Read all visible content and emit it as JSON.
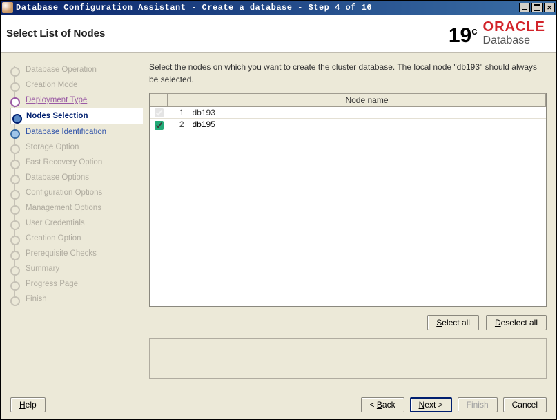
{
  "titlebar": {
    "text": "Database Configuration Assistant - Create a database - Step 4 of 16"
  },
  "header": {
    "page_title": "Select List of Nodes",
    "version_main": "19",
    "version_sup": "c",
    "brand_name": "ORACLE",
    "brand_sub": "Database"
  },
  "sidebar": {
    "steps": [
      {
        "label": "Database Operation",
        "state": "disabled"
      },
      {
        "label": "Creation Mode",
        "state": "disabled"
      },
      {
        "label": "Deployment Type",
        "state": "visited"
      },
      {
        "label": "Nodes Selection",
        "state": "current"
      },
      {
        "label": "Database Identification",
        "state": "upcoming"
      },
      {
        "label": "Storage Option",
        "state": "disabled"
      },
      {
        "label": "Fast Recovery Option",
        "state": "disabled"
      },
      {
        "label": "Database Options",
        "state": "disabled"
      },
      {
        "label": "Configuration Options",
        "state": "disabled"
      },
      {
        "label": "Management Options",
        "state": "disabled"
      },
      {
        "label": "User Credentials",
        "state": "disabled"
      },
      {
        "label": "Creation Option",
        "state": "disabled"
      },
      {
        "label": "Prerequisite Checks",
        "state": "disabled"
      },
      {
        "label": "Summary",
        "state": "disabled"
      },
      {
        "label": "Progress Page",
        "state": "disabled"
      },
      {
        "label": "Finish",
        "state": "disabled"
      }
    ]
  },
  "main": {
    "instruction": "Select the nodes on which you want to create the cluster database. The local node \"db193\" should always be selected.",
    "table": {
      "header_name": "Node name",
      "rows": [
        {
          "num": "1",
          "name": "db193",
          "checked": true,
          "locked": true
        },
        {
          "num": "2",
          "name": "db195",
          "checked": true,
          "locked": false
        }
      ]
    },
    "select_all": "Select all",
    "deselect_all": "Deselect all"
  },
  "footer": {
    "help": "Help",
    "back": "Back",
    "next": "Next",
    "finish": "Finish",
    "cancel": "Cancel"
  }
}
